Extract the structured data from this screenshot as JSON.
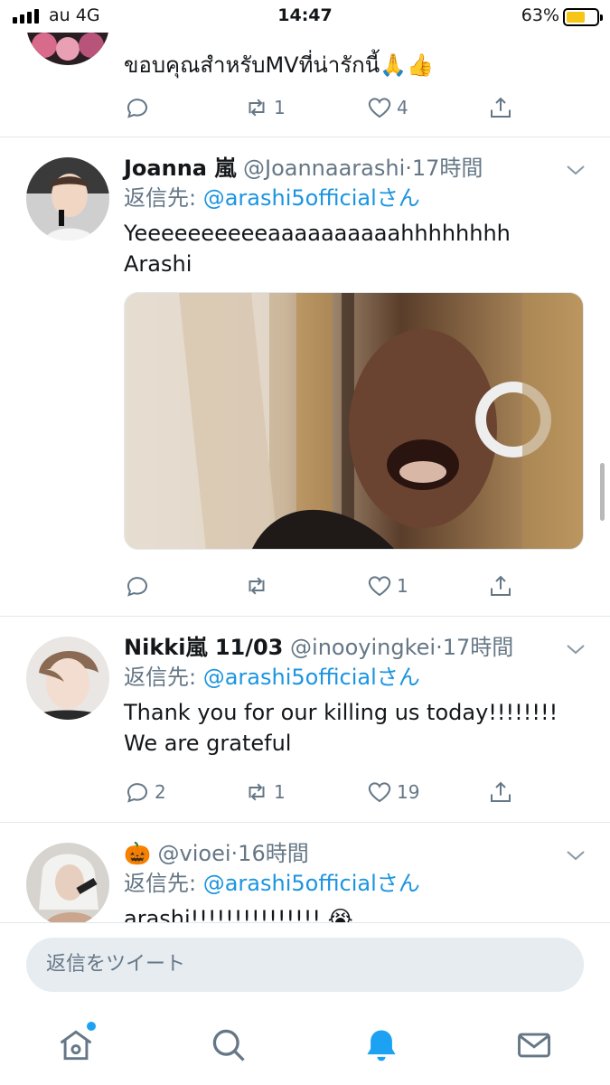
{
  "status_bar": {
    "carrier": "au 4G",
    "time": "14:47",
    "battery_percent": "63%",
    "battery_level": 0.63
  },
  "tweets": [
    {
      "body": "ขอบคุณสำหรับMVที่น่ารักนี้🙏👍",
      "reply_count": "",
      "retweet_count": "1",
      "like_count": "4"
    },
    {
      "name": "Joanna 嵐",
      "handle": "@Joannaarashi",
      "time": "17時間",
      "reply_prefix": "返信先: ",
      "reply_mention": "@arashi5official",
      "reply_suffix": "さん",
      "body_line1": "Yeeeeeeeeeeaaaaaaaaaahhhhhhhh",
      "body_line2": "Arashi",
      "reply_count": "",
      "retweet_count": "",
      "like_count": "1"
    },
    {
      "name": "Nikki嵐 11/03",
      "handle": "@inooyingkei",
      "time": "17時間",
      "reply_prefix": "返信先: ",
      "reply_mention": "@arashi5official",
      "reply_suffix": "さん",
      "body_line1": "Thank you for our killing us today!!!!!!!!",
      "body_line2": "We are grateful",
      "reply_count": "2",
      "retweet_count": "1",
      "like_count": "19"
    },
    {
      "name": "🎃",
      "handle": "@vioei",
      "time": "16時間",
      "reply_prefix": "返信先: ",
      "reply_mention": "@arashi5official",
      "reply_suffix": "さん",
      "body_line1": "arashi!!!!!!!!!!!!!!! 😭"
    }
  ],
  "compose": {
    "placeholder": "返信をツイート"
  },
  "tabs": [
    "home-icon",
    "search-icon",
    "bell-icon",
    "mail-icon"
  ],
  "colors": {
    "accent": "#1da1f2",
    "mention": "#1b95e0",
    "secondary_text": "#657786",
    "divider": "#e1e8ed"
  }
}
